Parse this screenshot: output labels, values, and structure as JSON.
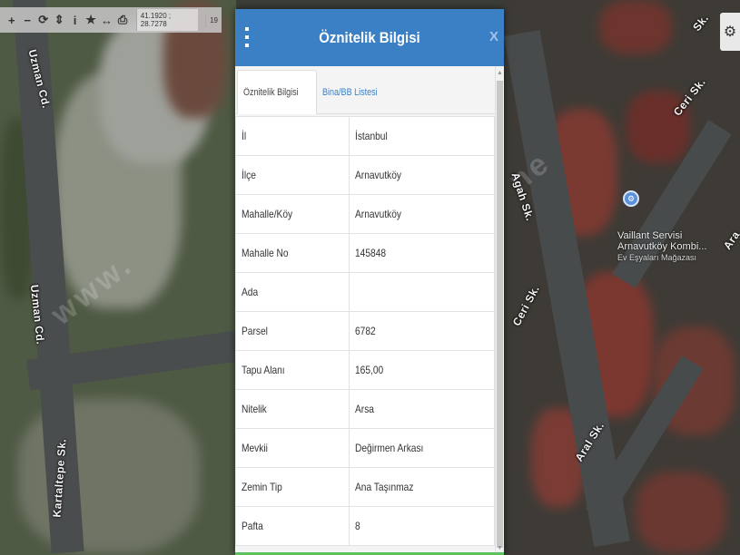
{
  "toolbar": {
    "icons": [
      "plus-icon",
      "minus-icon",
      "refresh-icon",
      "move-icon",
      "info-icon",
      "star-icon",
      "measure-icon",
      "print-icon"
    ],
    "glyphs": [
      "+",
      "−",
      "⟳",
      "⇕",
      "i",
      "★",
      "↔",
      "⎙"
    ],
    "coords": "41.1920 ; 28.7278",
    "zoom": "19"
  },
  "map_labels": {
    "uzman_top": "Uzman Cd.",
    "uzman_mid": "Uzman Cd.",
    "kartaltepe": "Kartaltepe Sk.",
    "ceri_top": "Ceri Sk.",
    "ceri_mid": "Ceri Sk.",
    "agah": "Agah Sk.",
    "aral": "Aral Sk.",
    "aral_right": "Ara",
    "sk_top": "Sk."
  },
  "poi": {
    "name": "Vaillant Servisi",
    "line2": "Arnavutköy Kombi...",
    "line3": "Ev Eşyaları Mağazası"
  },
  "dialog": {
    "title": "Öznitelik Bilgisi",
    "close": "X",
    "tabs": [
      "Öznitelik Bilgisi",
      "Bina/BB Listesi"
    ],
    "rows": [
      {
        "key": "İl",
        "value": "İstanbul"
      },
      {
        "key": "İlçe",
        "value": "Arnavutköy"
      },
      {
        "key": "Mahalle/Köy",
        "value": "Arnavutköy"
      },
      {
        "key": "Mahalle No",
        "value": "145848"
      },
      {
        "key": "Ada",
        "value": ""
      },
      {
        "key": "Parsel",
        "value": "6782"
      },
      {
        "key": "Tapu Alanı",
        "value": "165,00"
      },
      {
        "key": "Nitelik",
        "value": "Arsa"
      },
      {
        "key": "Mevkii",
        "value": "Değirmen Arkası"
      },
      {
        "key": "Zemin Tip",
        "value": "Ana Taşınmaz"
      },
      {
        "key": "Pafta",
        "value": "8"
      }
    ]
  },
  "colors": {
    "header": "#3b7fc4",
    "link": "#3b7fc4"
  }
}
